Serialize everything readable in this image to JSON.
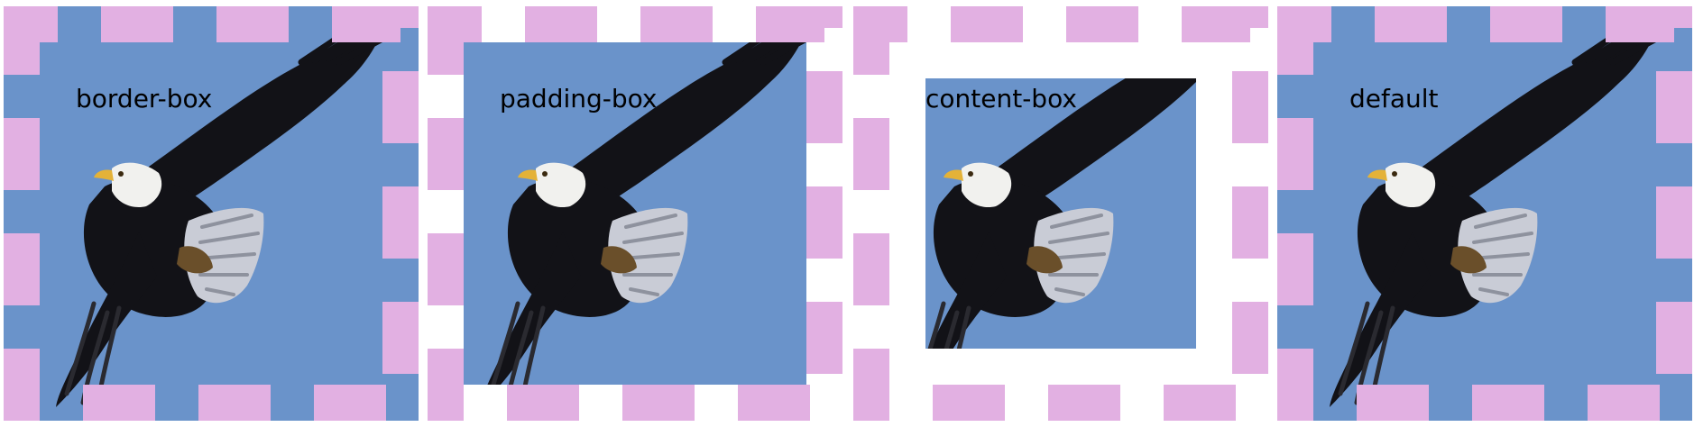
{
  "colors": {
    "sky": "#6a93ca",
    "dash": "#e2b0e2",
    "page": "#ffffff",
    "eagle_dark": "#121217",
    "eagle_mid": "#2a2a30",
    "feather_light": "#c9ccd6",
    "feather_shade": "#8e929e",
    "head": "#f1f1ee",
    "beak": "#e4b238",
    "patch": "#6a4f2a"
  },
  "icons": [
    "bald-eagle-image"
  ],
  "demos": [
    {
      "id": "border-box",
      "label": "border-box",
      "bg_clip": "border-box"
    },
    {
      "id": "padding-box",
      "label": "padding-box",
      "bg_clip": "padding-box"
    },
    {
      "id": "content-box",
      "label": "content-box",
      "bg_clip": "content-box"
    },
    {
      "id": "default",
      "label": "default",
      "bg_clip": "border-box"
    }
  ]
}
